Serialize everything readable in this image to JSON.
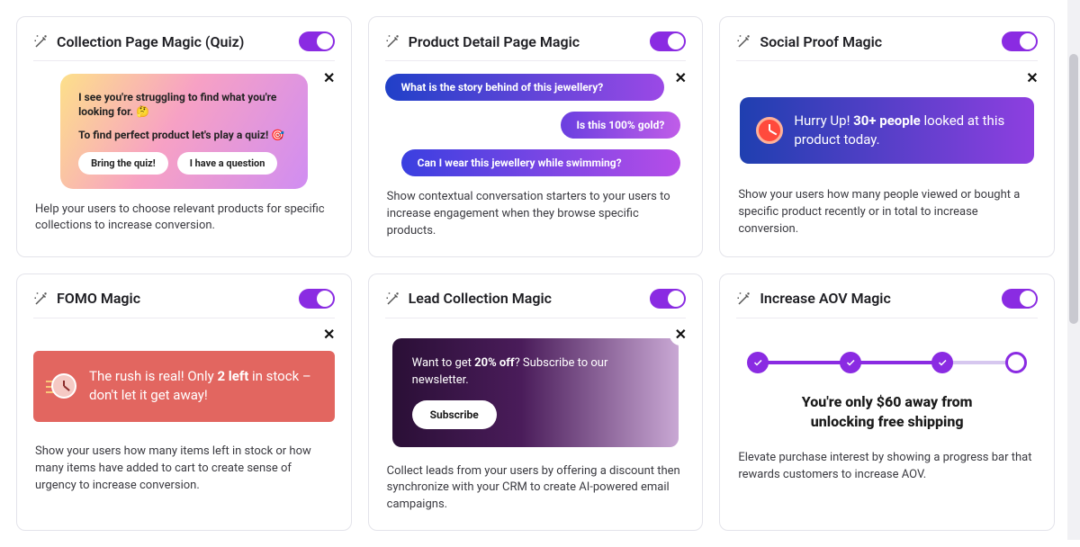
{
  "cards": [
    {
      "title": "Collection Page Magic (Quiz)",
      "desc": "Help your users to choose relevant products for specific collections to increase conversion.",
      "quiz": {
        "line1": "I see you're struggling to find what you're looking for. 🤔",
        "line2": "To find perfect product let's play a quiz! 🎯",
        "btn1": "Bring the quiz!",
        "btn2": "I have a question"
      }
    },
    {
      "title": "Product Detail Page Magic",
      "desc": "Show contextual conversation starters to your users to increase engagement when they browse specific products.",
      "pills": {
        "a": "What is the story behind of this jewellery?",
        "b": "Is this 100% gold?",
        "c": "Can I wear this jewellery while swimming?"
      }
    },
    {
      "title": "Social Proof Magic",
      "desc": "Show your users how many people viewed or bought a specific product recently or in total to increase conversion.",
      "social": {
        "prefix": "Hurry Up! ",
        "bold": "30+ people",
        "suffix": " looked at this product today."
      }
    },
    {
      "title": "FOMO Magic",
      "desc": "Show your users how many items left in stock or how many items have added to cart to create sense of urgency to increase conversion.",
      "fomo": {
        "prefix": "The rush is real! Only ",
        "bold": "2 left",
        "suffix": " in stock – don't let it get away!"
      }
    },
    {
      "title": "Lead Collection Magic",
      "desc": "Collect leads from your users by offering a discount then synchronize with your CRM to create AI-powered email campaigns.",
      "lead": {
        "prefix": "Want to get ",
        "bold": "20% off",
        "suffix": "? Subscribe to our newsletter.",
        "btn": "Subscribe"
      }
    },
    {
      "title": "Increase AOV Magic",
      "desc": "Elevate purchase interest by showing a progress bar that rewards customers to increase AOV.",
      "aov": {
        "line1": "You're only $60 away from",
        "line2": "unlocking free shipping"
      }
    }
  ],
  "close_label": "✕"
}
